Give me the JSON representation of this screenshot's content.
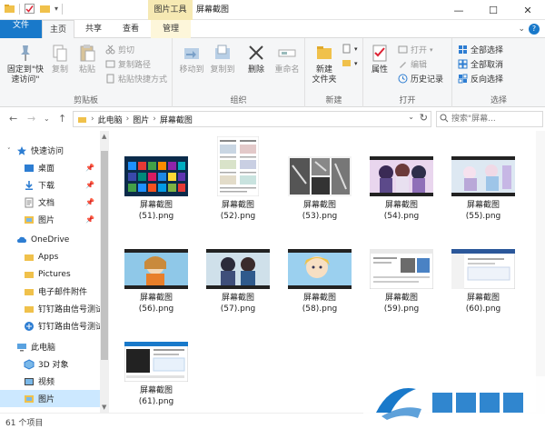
{
  "titlebar": {
    "context_tab_title": "图片工具",
    "window_title": "屏幕截图",
    "minimize": "—",
    "maximize": "☐",
    "close": "✕"
  },
  "tabs": {
    "file": "文件",
    "home": "主页",
    "share": "共享",
    "view": "查看",
    "manage": "管理",
    "ribbon_toggle": "⌄",
    "help": "?"
  },
  "ribbon": {
    "clipboard": {
      "label": "剪贴板",
      "pin_quick": "固定到\"快\n速访问\"",
      "copy": "复制",
      "paste": "粘贴",
      "cut": "剪切",
      "copy_path": "复制路径",
      "paste_shortcut": "粘贴快捷方式"
    },
    "organize": {
      "label": "组织",
      "move_to": "移动到",
      "copy_to": "复制到",
      "delete": "删除",
      "rename": "重命名"
    },
    "new": {
      "label": "新建",
      "new_folder": "新建\n文件夹"
    },
    "open": {
      "label": "打开",
      "properties": "属性",
      "open": "打开",
      "edit": "编辑",
      "history": "历史记录"
    },
    "select": {
      "label": "选择",
      "select_all": "全部选择",
      "select_none": "全部取消",
      "invert": "反向选择"
    }
  },
  "address": {
    "crumbs": [
      "此电脑",
      "图片",
      "屏幕截图"
    ],
    "search_placeholder": "搜索\"屏幕..."
  },
  "nav": {
    "items": [
      {
        "label": "快速访问",
        "icon": "star-icon"
      },
      {
        "label": "桌面",
        "icon": "desktop-folder-icon",
        "pinned": true
      },
      {
        "label": "下载",
        "icon": "download-folder-icon",
        "pinned": true
      },
      {
        "label": "文档",
        "icon": "documents-folder-icon",
        "pinned": true
      },
      {
        "label": "图片",
        "icon": "pictures-folder-icon",
        "pinned": true
      },
      {
        "label": "OneDrive",
        "icon": "cloud-icon"
      },
      {
        "label": "Apps",
        "icon": "folder-icon"
      },
      {
        "label": "Pictures",
        "icon": "folder-icon"
      },
      {
        "label": "电子邮件附件",
        "icon": "folder-icon"
      },
      {
        "label": "钉钉路由信号测试",
        "icon": "folder-icon"
      },
      {
        "label": "钉钉路由信号测试",
        "icon": "network-icon"
      },
      {
        "label": "此电脑",
        "icon": "computer-icon"
      },
      {
        "label": "3D 对象",
        "icon": "cube-icon"
      },
      {
        "label": "视频",
        "icon": "video-folder-icon"
      },
      {
        "label": "图片",
        "icon": "pictures-folder-icon"
      }
    ],
    "pin_glyph": "📌"
  },
  "files": [
    {
      "name": "屏幕截图",
      "ext": "(51).png"
    },
    {
      "name": "屏幕截图",
      "ext": "(52).png"
    },
    {
      "name": "屏幕截图",
      "ext": "(53).png"
    },
    {
      "name": "屏幕截图",
      "ext": "(54).png"
    },
    {
      "name": "屏幕截图",
      "ext": "(55).png"
    },
    {
      "name": "屏幕截图",
      "ext": "(56).png"
    },
    {
      "name": "屏幕截图",
      "ext": "(57).png"
    },
    {
      "name": "屏幕截图",
      "ext": "(58).png"
    },
    {
      "name": "屏幕截图",
      "ext": "(59).png"
    },
    {
      "name": "屏幕截图",
      "ext": "(60).png"
    },
    {
      "name": "屏幕截图",
      "ext": "(61).png"
    }
  ],
  "status": {
    "count": "61 个项目"
  },
  "colors": {
    "accent": "#1979ca",
    "context_tab": "#f6e9b3",
    "selected": "#cce8ff",
    "folder": "#f0c14b"
  }
}
